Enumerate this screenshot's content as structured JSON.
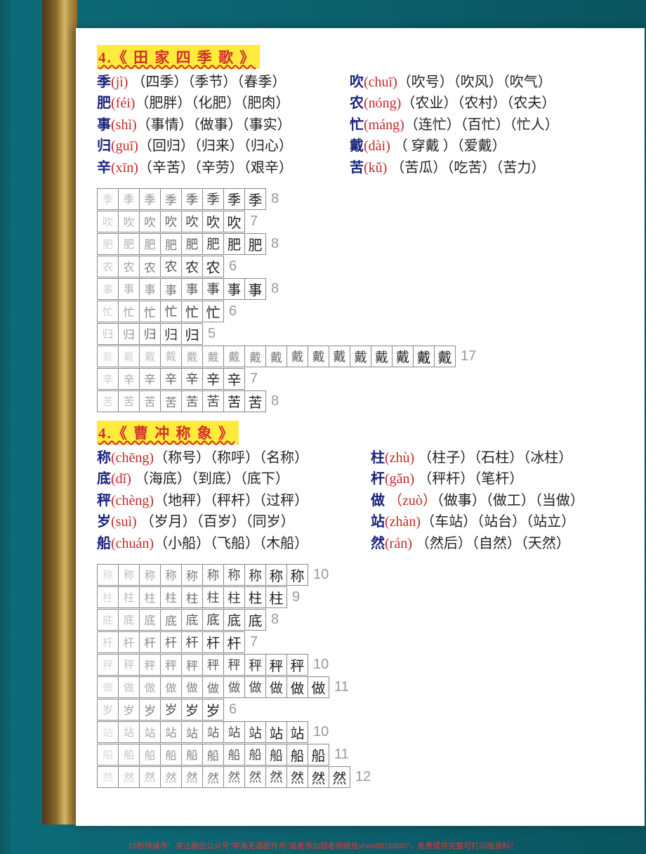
{
  "footer": "10秒钟操作！关注微信公众号\"学海无涯甜作舟\"或者添加甜老师微信shen88168007，免费提供完整可打印版资料！",
  "sections": [
    {
      "title": "4.《 田 家 四 季 歌  》",
      "vocab_rows": [
        {
          "left": {
            "char": "季",
            "pinyin": "(jì)",
            "words": " （四季）（季节）（春季）"
          },
          "right": {
            "char": "吹",
            "pinyin": "(chuī)",
            "words": "（吹号）（吹风）（吹气）"
          }
        },
        {
          "left": {
            "char": "肥",
            "pinyin": "(féi)",
            "words": "（肥胖）（化肥）（肥肉）"
          },
          "right": {
            "char": "农",
            "pinyin": "(nóng)",
            "words": "（农业）（农村）（农夫）"
          }
        },
        {
          "left": {
            "char": "事",
            "pinyin": "(shì)",
            "words": "（事情）（做事）（事实）"
          },
          "right": {
            "char": "忙",
            "pinyin": "(máng)",
            "words": "（连忙）（百忙）（忙人）"
          }
        },
        {
          "left": {
            "char": "归",
            "pinyin": "(guī)",
            "words": "（回归）（归来）（归心）"
          },
          "right": {
            "char": "戴",
            "pinyin": "(dài)",
            "words": " （ 穿戴 ）（爱戴）"
          }
        },
        {
          "left": {
            "char": "辛",
            "pinyin": "(xīn)",
            "words": "（辛苦）（辛劳）（艰辛）"
          },
          "right": {
            "char": "苦",
            "pinyin": "(kǔ)",
            "words": " （苦瓜）（吃苦）（苦力）"
          }
        }
      ],
      "strokes": [
        {
          "final": "季",
          "count": 8
        },
        {
          "final": "吹",
          "count": 7
        },
        {
          "final": "肥",
          "count": 8
        },
        {
          "final": "农",
          "count": 6
        },
        {
          "final": "事",
          "count": 8
        },
        {
          "final": "忙",
          "count": 6
        },
        {
          "final": "归",
          "count": 5
        },
        {
          "final": "戴",
          "count": 17
        },
        {
          "final": "辛",
          "count": 7
        },
        {
          "final": "苦",
          "count": 8
        }
      ]
    },
    {
      "title": "4.《 曹 冲 称 象  》",
      "vocab_rows": [
        {
          "left": {
            "char": "称",
            "pinyin": "(chēng)",
            "words": "（称号）（称呼）（名称）"
          },
          "right": {
            "char": "柱",
            "pinyin": "(zhù)",
            "words": " （柱子）（石柱）（冰柱）"
          }
        },
        {
          "left": {
            "char": "底",
            "pinyin": "(dǐ)",
            "words": "  （海底）（到底）（底下）"
          },
          "right": {
            "char": "杆",
            "pinyin": "(gǎn)",
            "words": " （秤杆）（笔杆）"
          }
        },
        {
          "left": {
            "char": "秤",
            "pinyin": "(chèng)",
            "words": "（地秤）（秤杆）（过秤）"
          },
          "right": {
            "char": "做",
            "pinyin": " （zuò）",
            "words": "（做事）（做工）（当做）"
          }
        },
        {
          "left": {
            "char": "岁",
            "pinyin": "(suì)",
            "words": " （岁月）（百岁）（同岁）"
          },
          "right": {
            "char": "站",
            "pinyin": "(zhàn)",
            "words": "（车站）（站台）（站立）"
          }
        },
        {
          "left": {
            "char": "船",
            "pinyin": "(chuán)",
            "words": "（小船）（飞船）（木船）"
          },
          "right": {
            "char": "然",
            "pinyin": "(rán)",
            "words": " （然后）（自然）（天然）"
          }
        }
      ],
      "strokes": [
        {
          "final": "称",
          "count": 10
        },
        {
          "final": "柱",
          "count": 9
        },
        {
          "final": "底",
          "count": 8
        },
        {
          "final": "杆",
          "count": 7
        },
        {
          "final": "秤",
          "count": 10
        },
        {
          "final": "做",
          "count": 11
        },
        {
          "final": "岁",
          "count": 6
        },
        {
          "final": "站",
          "count": 10
        },
        {
          "final": "船",
          "count": 11
        },
        {
          "final": "然",
          "count": 12
        }
      ]
    }
  ]
}
